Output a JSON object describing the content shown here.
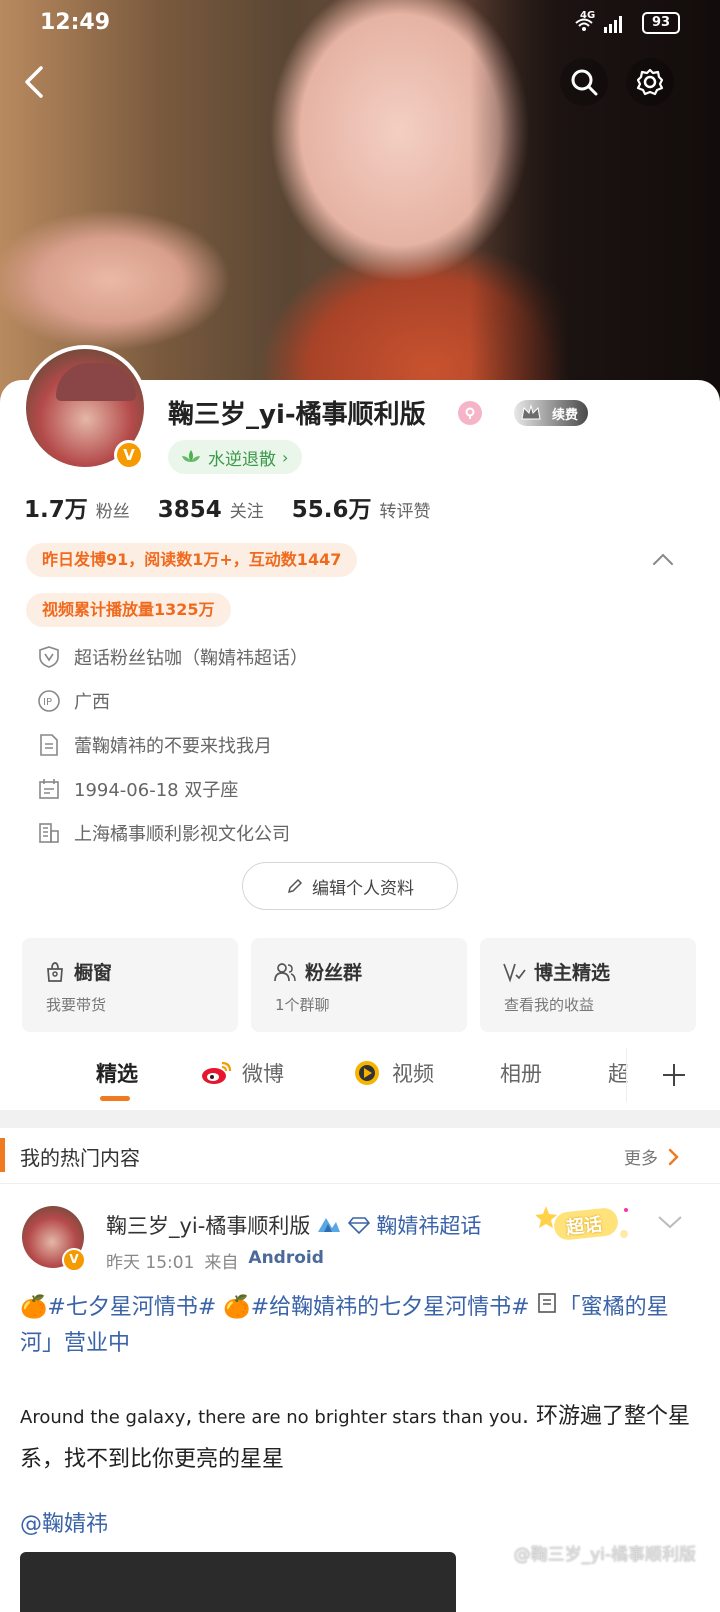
{
  "status": {
    "time": "12:49",
    "network": "4G",
    "battery": "93"
  },
  "profile": {
    "name": "鞠三岁_yi-橘事顺利版",
    "vip_label": "续费",
    "tag_label": "水逆退散",
    "stats": [
      {
        "num": "1.7万",
        "label": "粉丝"
      },
      {
        "num": "3854",
        "label": "关注"
      },
      {
        "num": "55.6万",
        "label": "转评赞"
      }
    ],
    "highlight_1": "昨日发博91，阅读数1万+，互动数1447",
    "highlight_2": "视频累计播放量1325万",
    "info": {
      "supertopic": "超话粉丝钻咖（鞠婧祎超话）",
      "ip": "广西",
      "bio": "蕾鞠婧祎的不要来找我月",
      "birthday": "1994-06-18 双子座",
      "company": "上海橘事顺利影视文化公司"
    },
    "edit_button": "编辑个人资料"
  },
  "cards": [
    {
      "title": "橱窗",
      "sub": "我要带货",
      "icon": "bag-icon"
    },
    {
      "title": "粉丝群",
      "sub": "1个群聊",
      "icon": "group-icon"
    },
    {
      "title": "博主精选",
      "sub": "查看我的收益",
      "icon": "select-icon"
    }
  ],
  "tabs": [
    "精选",
    "微博",
    "视频",
    "相册",
    "超"
  ],
  "hot": {
    "title": "我的热门内容",
    "more": "更多"
  },
  "post": {
    "author": "鞠三岁_yi-橘事顺利版",
    "topic_link": "鞠婧祎超话",
    "badge": "超话",
    "time": "昨天 15:01",
    "source_prefix": "来自",
    "source": "Android",
    "topic_1": "#七夕星河情书#",
    "topic_2": "#给鞠婧祎的七夕星河情书#",
    "article": "「蜜橘的星河」营业中",
    "en_1": "Around the galaxy",
    "en_comma": ",",
    "en_2": " there are no brighter stars than you",
    "en_dot": ".",
    "zh": " 环游遍了整个星系，找不到比你更亮的星星",
    "mention": "@鞠婧祎"
  },
  "watermark": "@鞠三岁_yi-橘事顺利版"
}
